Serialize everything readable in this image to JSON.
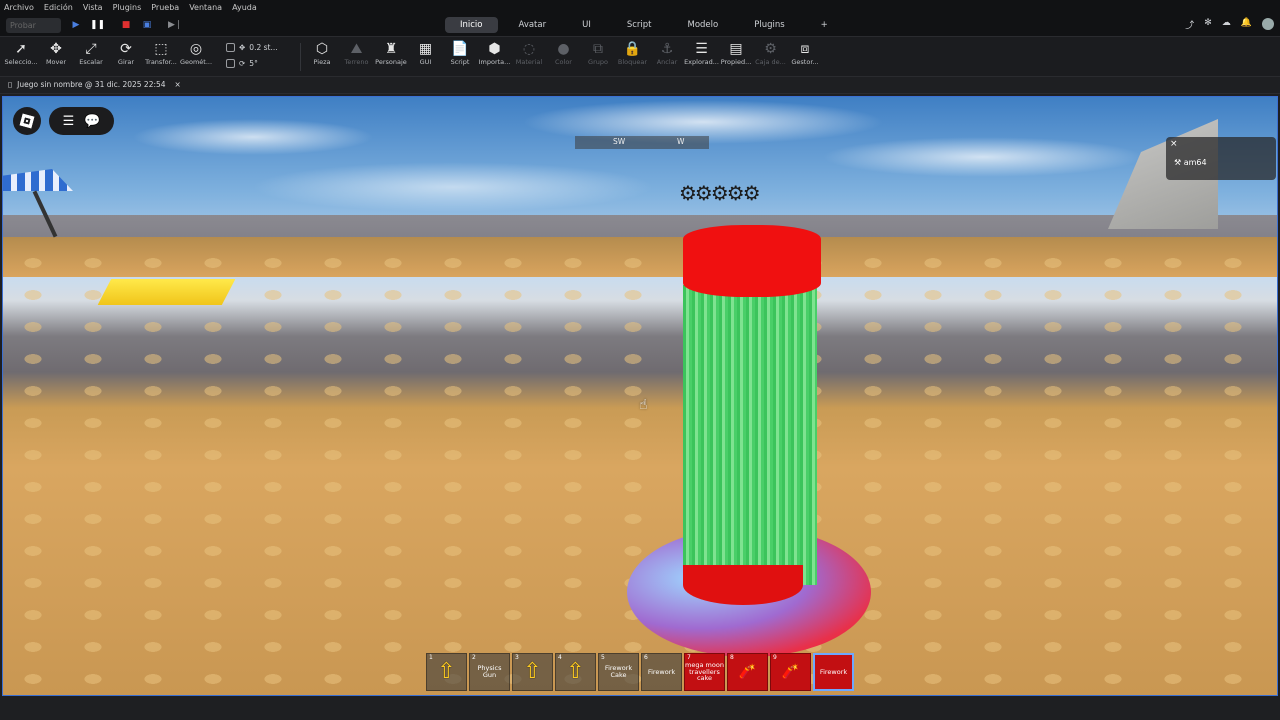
{
  "menu": [
    "Archivo",
    "Edición",
    "Vista",
    "Plugins",
    "Prueba",
    "Ventana",
    "Ayuda"
  ],
  "topbar": {
    "play_select": "Probar",
    "tabs": [
      "Inicio",
      "Avatar",
      "UI",
      "Script",
      "Modelo",
      "Plugins"
    ],
    "active_tab": "Inicio",
    "add_tab": "+"
  },
  "ribbon": {
    "tools": [
      {
        "label": "Seleccio...",
        "icon": "select-icon",
        "glyph": "➚"
      },
      {
        "label": "Mover",
        "icon": "move-icon",
        "glyph": "✥"
      },
      {
        "label": "Escalar",
        "icon": "scale-icon",
        "glyph": "⤢"
      },
      {
        "label": "Girar",
        "icon": "rotate-icon",
        "glyph": "⟳"
      },
      {
        "label": "Transfor...",
        "icon": "transform-icon",
        "glyph": "⬚"
      },
      {
        "label": "Geomét...",
        "icon": "geometry-icon",
        "glyph": "◎"
      }
    ],
    "move_step": "0.2 st...",
    "rotate_step": "5°",
    "tools2": [
      {
        "label": "Pieza",
        "icon": "part-icon",
        "glyph": "⬡",
        "dim": false
      },
      {
        "label": "Terreno",
        "icon": "terrain-icon",
        "glyph": "⛰",
        "dim": true
      },
      {
        "label": "Personaje",
        "icon": "character-icon",
        "glyph": "♜",
        "dim": false
      },
      {
        "label": "GUI",
        "icon": "gui-icon",
        "glyph": "▦",
        "dim": false
      },
      {
        "label": "Script",
        "icon": "script-icon",
        "glyph": "📄",
        "dim": false
      },
      {
        "label": "Importa...",
        "icon": "import-icon",
        "glyph": "⬢",
        "dim": false
      },
      {
        "label": "Material",
        "icon": "material-icon",
        "glyph": "◌",
        "dim": true
      },
      {
        "label": "Color",
        "icon": "color-icon",
        "glyph": "●",
        "dim": true
      },
      {
        "label": "Grupo",
        "icon": "group-icon",
        "glyph": "⧉",
        "dim": true
      },
      {
        "label": "Bloquear",
        "icon": "lock-icon",
        "glyph": "🔒",
        "dim": true
      },
      {
        "label": "Anclar",
        "icon": "anchor-icon",
        "glyph": "⚓",
        "dim": true
      },
      {
        "label": "Explorad...",
        "icon": "explorer-icon",
        "glyph": "☰",
        "dim": false
      },
      {
        "label": "Propied...",
        "icon": "properties-icon",
        "glyph": "▤",
        "dim": false
      },
      {
        "label": "Caja de...",
        "icon": "toolbox-icon",
        "glyph": "⚙",
        "dim": true
      },
      {
        "label": "Gestor...",
        "icon": "manager-icon",
        "glyph": "⧈",
        "dim": false
      }
    ]
  },
  "doc_tab": {
    "title": "Juego sin nombre @ 31 dic. 2025 22:54",
    "close": "×"
  },
  "viewport": {
    "compass": {
      "left": "SW",
      "right": "W"
    },
    "player_name": "am64",
    "player_close": "×"
  },
  "hotbar": [
    {
      "num": "1",
      "label": "",
      "icon": "arrow-up-icon",
      "red": false,
      "sel": false
    },
    {
      "num": "2",
      "label": "Physics Gun",
      "icon": "",
      "red": false,
      "sel": false
    },
    {
      "num": "3",
      "label": "",
      "icon": "arrow-up-icon",
      "red": false,
      "sel": false
    },
    {
      "num": "4",
      "label": "",
      "icon": "arrow-up-icon",
      "red": false,
      "sel": false
    },
    {
      "num": "5",
      "label": "Firework Cake",
      "icon": "",
      "red": false,
      "sel": false
    },
    {
      "num": "6",
      "label": "Firework",
      "icon": "",
      "red": false,
      "sel": false
    },
    {
      "num": "7",
      "label": "mega moon travellers cake",
      "icon": "",
      "red": true,
      "sel": false
    },
    {
      "num": "8",
      "label": "",
      "icon": "rocket-icon",
      "red": true,
      "sel": false
    },
    {
      "num": "9",
      "label": "",
      "icon": "rocket-icon",
      "red": true,
      "sel": false
    },
    {
      "num": "",
      "label": "Firework",
      "icon": "",
      "red": true,
      "sel": true
    }
  ]
}
